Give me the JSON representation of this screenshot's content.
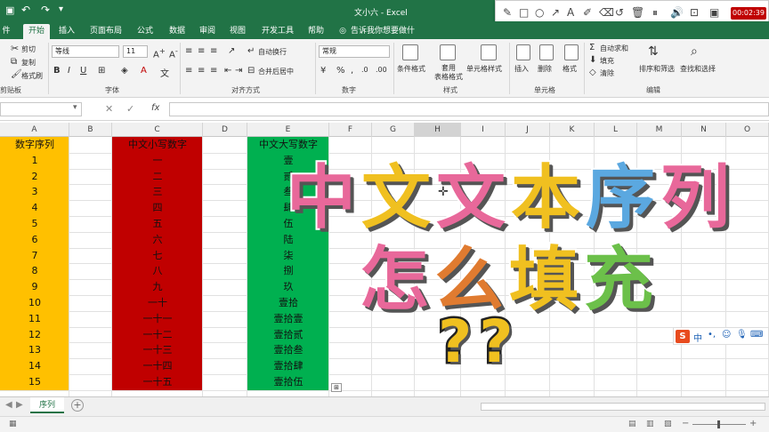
{
  "window": {
    "title": "文小六 - Excel"
  },
  "menu": {
    "tabs": [
      "件",
      "开始",
      "插入",
      "页面布局",
      "公式",
      "数据",
      "审阅",
      "视图",
      "开发工具",
      "帮助",
      "告诉我你想要做什么"
    ],
    "active": 1
  },
  "ribbon": {
    "clipboard": {
      "cut": "剪切",
      "copy": "复制",
      "format_painter": "格式刷",
      "group": "剪贴板"
    },
    "font": {
      "name": "等线",
      "size": "11",
      "group": "字体"
    },
    "alignment": {
      "wrap": "自动换行",
      "merge": "合并后居中",
      "group": "对齐方式"
    },
    "number": {
      "format": "常规",
      "group": "数字"
    },
    "styles": {
      "conditional": "条件格式",
      "table": "套用\n表格格式",
      "cell_styles": "单元格样式",
      "group": "样式"
    },
    "cells": {
      "insert": "插入",
      "delete": "删除",
      "format": "格式",
      "group": "单元格"
    },
    "editing": {
      "autosum": "自动求和",
      "fill": "填充",
      "clear": "清除",
      "sort": "排序和筛选",
      "find": "查找和选择",
      "group": "编辑"
    }
  },
  "drawtools": {
    "timer": "00:02:39"
  },
  "columns": [
    "A",
    "B",
    "C",
    "D",
    "E",
    "F",
    "G",
    "H",
    "I",
    "J",
    "K",
    "L",
    "M",
    "N",
    "O"
  ],
  "selected_column": "H",
  "sheet": {
    "headers": {
      "a": "数字序列",
      "c": "中文小写数字",
      "e": "中文大写数字"
    },
    "rows": [
      {
        "a": "1",
        "c": "一",
        "e": "壹"
      },
      {
        "a": "2",
        "c": "二",
        "e": "贰"
      },
      {
        "a": "3",
        "c": "三",
        "e": "叁"
      },
      {
        "a": "4",
        "c": "四",
        "e": "肆"
      },
      {
        "a": "5",
        "c": "五",
        "e": "伍"
      },
      {
        "a": "6",
        "c": "六",
        "e": "陆"
      },
      {
        "a": "7",
        "c": "七",
        "e": "柒"
      },
      {
        "a": "8",
        "c": "八",
        "e": "捌"
      },
      {
        "a": "9",
        "c": "九",
        "e": "玖"
      },
      {
        "a": "10",
        "c": "一十",
        "e": "壹拾"
      },
      {
        "a": "11",
        "c": "一十一",
        "e": "壹拾壹"
      },
      {
        "a": "12",
        "c": "一十二",
        "e": "壹拾贰"
      },
      {
        "a": "13",
        "c": "一十三",
        "e": "壹拾叁"
      },
      {
        "a": "14",
        "c": "一十四",
        "e": "壹拾肆"
      },
      {
        "a": "15",
        "c": "一十五",
        "e": "壹拾伍"
      }
    ],
    "colors": {
      "a": "#FFC000",
      "c": "#C00000",
      "e": "#00B050"
    }
  },
  "overlay": {
    "line1": [
      "中",
      "文",
      "文",
      "本",
      "序",
      "列"
    ],
    "line1_colors": [
      "#E8689A",
      "#F0C020",
      "#E8689A",
      "#F0C020",
      "#5BA8E0",
      "#E8689A"
    ],
    "line2": [
      "怎",
      "么",
      "填",
      "充"
    ],
    "line2_colors": [
      "#E8689A",
      "#E07B30",
      "#F0C020",
      "#6CC04A"
    ],
    "marks": "??",
    "ime": "中"
  },
  "sheet_tab": "序列"
}
